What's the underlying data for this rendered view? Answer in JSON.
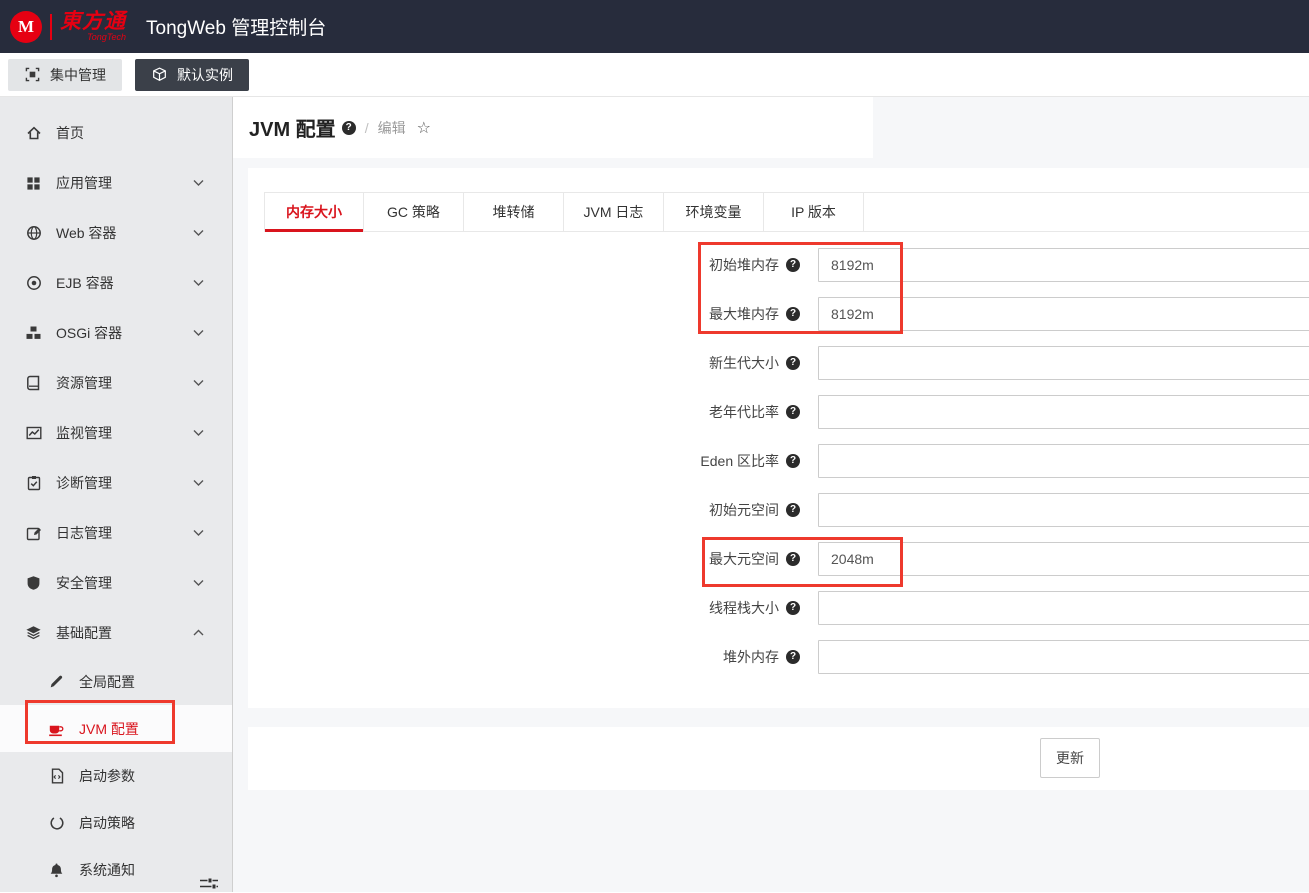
{
  "colors": {
    "accent_red": "#d9141d",
    "annotation_red": "#ee392d",
    "header_bg": "#272c3c",
    "brand_red": "#e60012",
    "sidebar_bg": "#e9eaec",
    "main_bg": "#f6f7f9"
  },
  "header": {
    "logo_monogram": "M",
    "brand": "東方通",
    "brand_sub": "TongTech",
    "app_title": "TongWeb 管理控制台"
  },
  "toolbar": {
    "central_management_label": "集中管理",
    "default_instance_label": "默认实例"
  },
  "sidebar": {
    "items": [
      {
        "label": "首页",
        "icon": "home-icon"
      },
      {
        "label": "应用管理",
        "icon": "apps-icon"
      },
      {
        "label": "Web 容器",
        "icon": "globe-icon"
      },
      {
        "label": "EJB 容器",
        "icon": "target-icon"
      },
      {
        "label": "OSGi 容器",
        "icon": "cubes-icon"
      },
      {
        "label": "资源管理",
        "icon": "book-icon"
      },
      {
        "label": "监视管理",
        "icon": "chart-icon"
      },
      {
        "label": "诊断管理",
        "icon": "clipboard-icon"
      },
      {
        "label": "日志管理",
        "icon": "edit-icon"
      },
      {
        "label": "安全管理",
        "icon": "shield-icon"
      },
      {
        "label": "基础配置",
        "icon": "layers-icon"
      }
    ],
    "subitems": [
      {
        "label": "全局配置",
        "icon": "pencil-icon",
        "active": false
      },
      {
        "label": "JVM 配置",
        "icon": "coffee-icon",
        "active": true
      },
      {
        "label": "启动参数",
        "icon": "file-code-icon",
        "active": false
      },
      {
        "label": "启动策略",
        "icon": "circle-icon",
        "active": false
      },
      {
        "label": "系统通知",
        "icon": "bell-icon",
        "active": false
      }
    ]
  },
  "page": {
    "title": "JVM 配置",
    "breadcrumb_separator": "/",
    "breadcrumb_current": "编辑"
  },
  "tabs": [
    {
      "label": "内存大小",
      "active": true
    },
    {
      "label": "GC 策略",
      "active": false
    },
    {
      "label": "堆转储",
      "active": false
    },
    {
      "label": "JVM 日志",
      "active": false
    },
    {
      "label": "环境变量",
      "active": false
    },
    {
      "label": "IP 版本",
      "active": false
    }
  ],
  "form": {
    "fields": [
      {
        "label": "初始堆内存",
        "value": "8192m"
      },
      {
        "label": "最大堆内存",
        "value": "8192m"
      },
      {
        "label": "新生代大小",
        "value": ""
      },
      {
        "label": "老年代比率",
        "value": ""
      },
      {
        "label": "Eden 区比率",
        "value": ""
      },
      {
        "label": "初始元空间",
        "value": ""
      },
      {
        "label": "最大元空间",
        "value": "2048m"
      },
      {
        "label": "线程栈大小",
        "value": ""
      },
      {
        "label": "堆外内存",
        "value": ""
      }
    ],
    "submit_label": "更新"
  }
}
